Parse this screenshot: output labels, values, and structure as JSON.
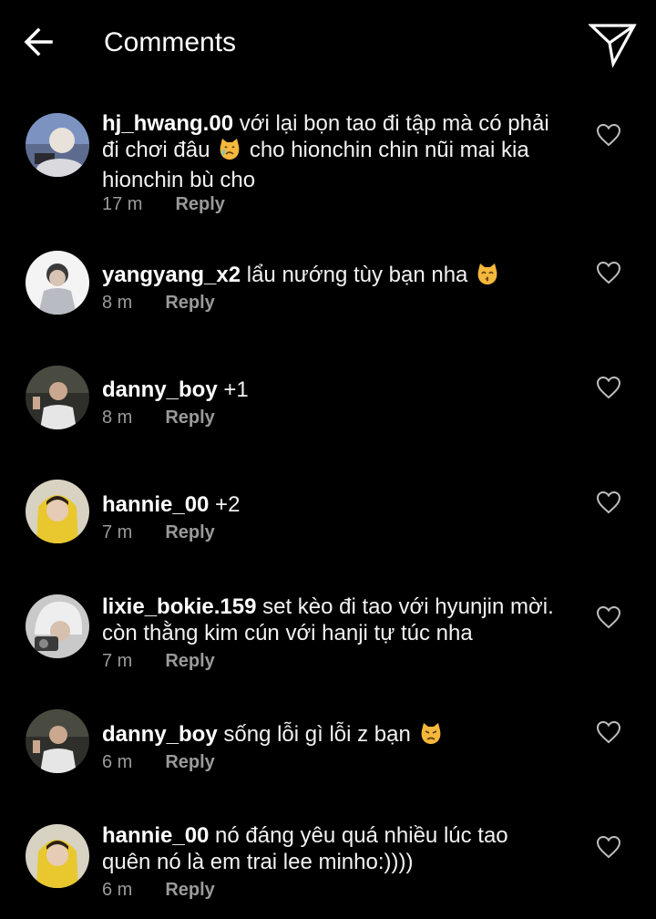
{
  "header": {
    "title": "Comments",
    "back_icon": "arrow-left-icon",
    "send_icon": "paper-plane-icon"
  },
  "reply_label": "Reply",
  "comments": [
    {
      "username": "hj_hwang.00",
      "text_before": " với lại bọn tao đi tập mà có phải đi chơi đâu ",
      "emoji": "crying-cat-emoji",
      "text_after": " cho hionchin chin nũi mai kia hionchin bù cho",
      "time": "17 m"
    },
    {
      "username": "yangyang_x2",
      "text_before": " lẩu nướng tùy bạn nha ",
      "emoji": "kissing-cat-emoji",
      "text_after": "",
      "time": "8 m"
    },
    {
      "username": "danny_boy",
      "text_before": " +1",
      "emoji": "",
      "text_after": "",
      "time": "8 m"
    },
    {
      "username": "hannie_00",
      "text_before": " +2",
      "emoji": "",
      "text_after": "",
      "time": "7 m"
    },
    {
      "username": "lixie_bokie.159",
      "text_before": " set kèo đi tao với hyunjin mời. còn thằng kim cún với hanji tự túc nha",
      "emoji": "",
      "text_after": "",
      "time": "7 m"
    },
    {
      "username": "danny_boy",
      "text_before": " sống lỗi gì lỗi z bạn ",
      "emoji": "pouting-cat-emoji",
      "text_after": "",
      "time": "6 m"
    },
    {
      "username": "hannie_00",
      "text_before": " nó đáng yêu quá nhiều lúc tao quên nó là em trai lee minho:))))",
      "emoji": "",
      "text_after": "",
      "time": "6 m"
    }
  ],
  "colors": {
    "background": "#000000",
    "text": "#ffffff",
    "meta": "#9a9a9a",
    "emoji": "#f5b83d"
  }
}
